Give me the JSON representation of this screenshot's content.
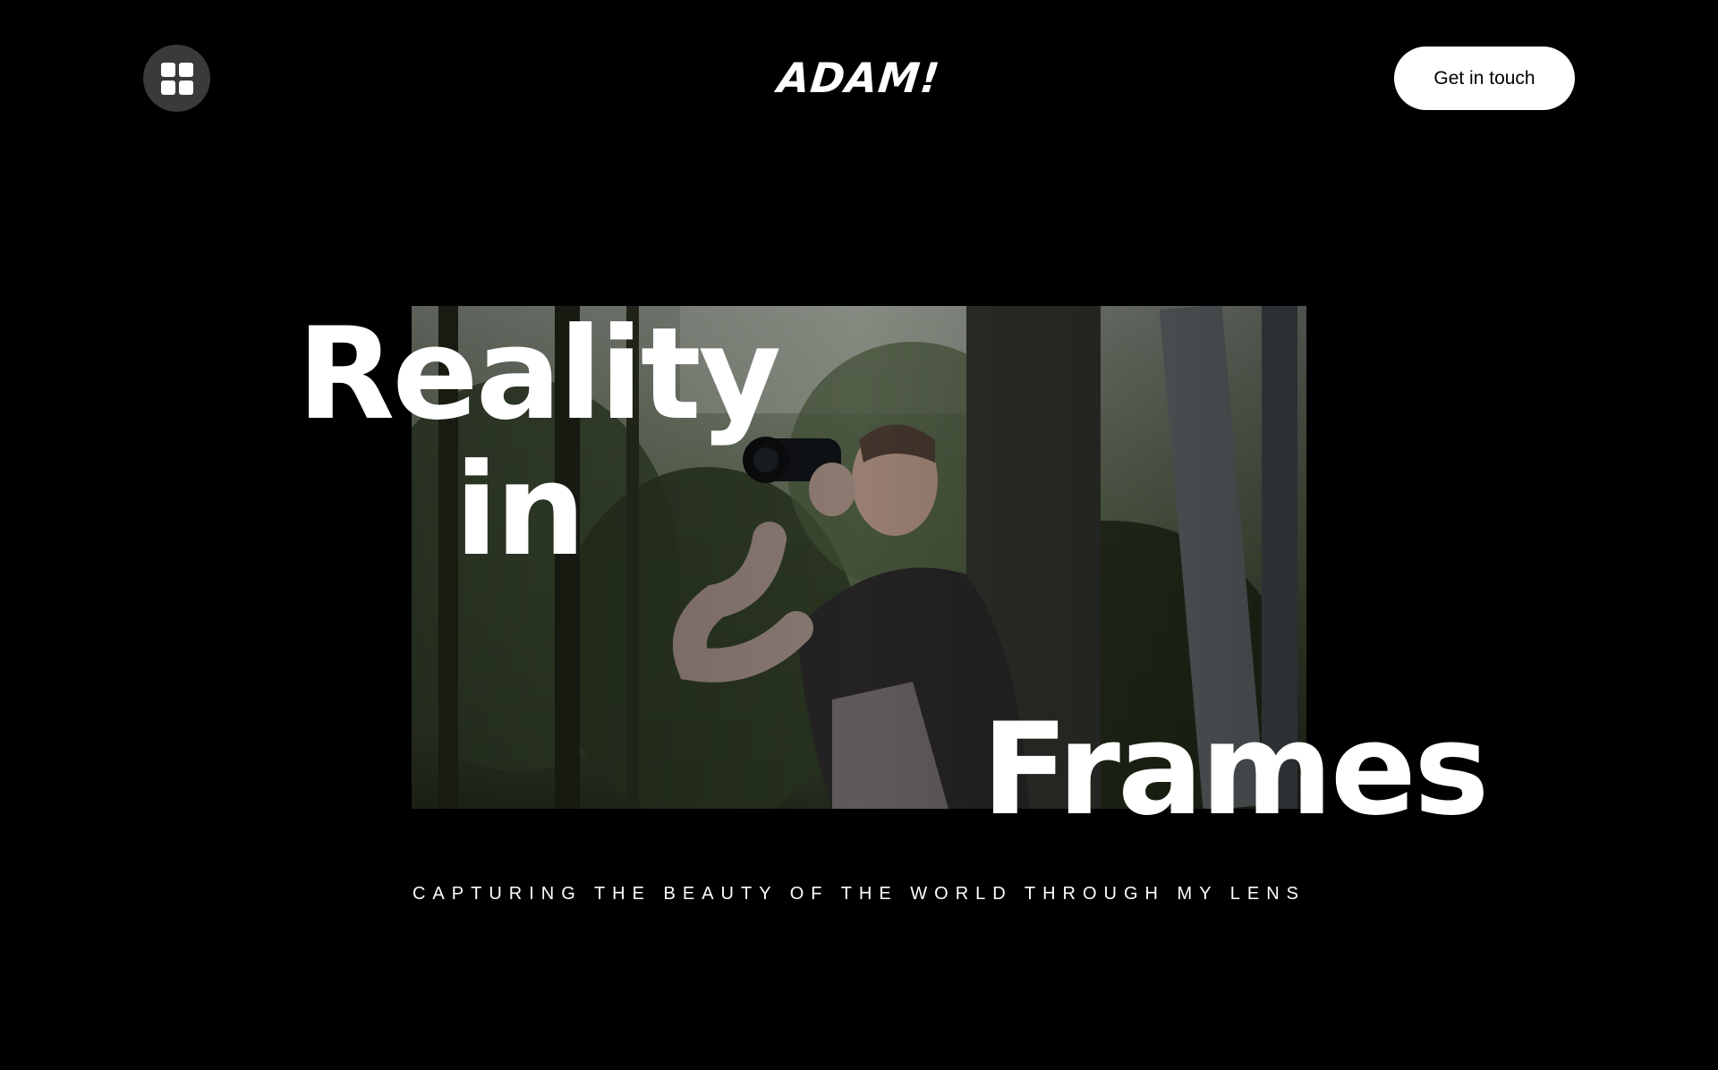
{
  "header": {
    "menu_icon": "grid-icon",
    "logo": "ADAM!",
    "cta_label": "Get in touch"
  },
  "hero": {
    "headline": {
      "word1": "Reality",
      "word2": "in",
      "word3": "Frames"
    },
    "photo_description_icon": "photographer-photo",
    "tagline": "CAPTURING THE BEAUTY OF THE WORLD THROUGH MY LENS"
  },
  "colors": {
    "background": "#000000",
    "text": "#ffffff",
    "menu_button": "#3a3a3a",
    "cta_background": "#ffffff",
    "cta_text": "#000000"
  }
}
